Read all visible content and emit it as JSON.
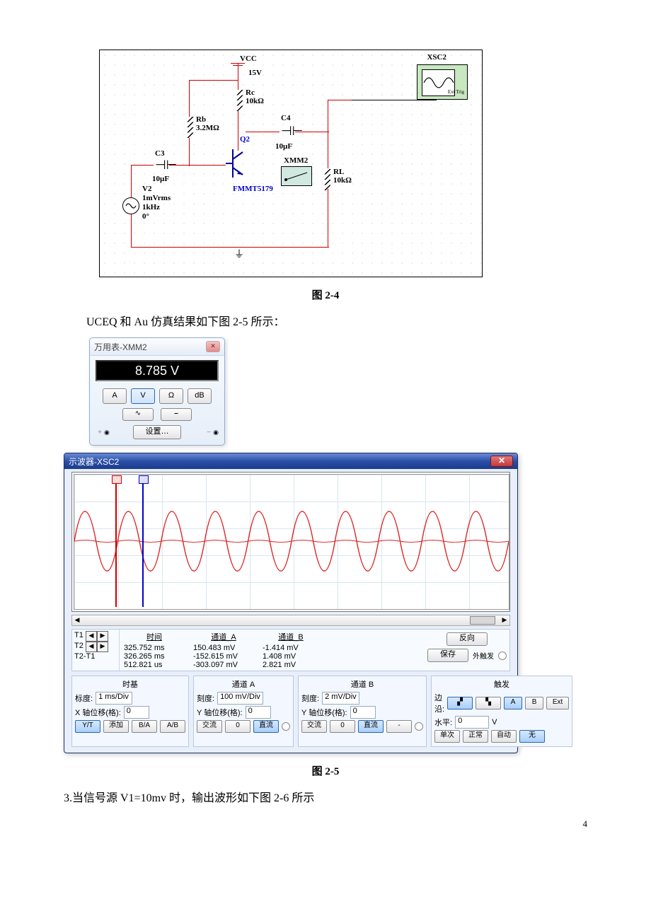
{
  "page_number": "4",
  "circuit": {
    "vcc_label": "VCC",
    "vcc_value": "15V",
    "rc_name": "Rc",
    "rc_value": "10kΩ",
    "rb_name": "Rb",
    "rb_value": "3.2MΩ",
    "c3_name": "C3",
    "c3_value": "10µF",
    "c4_name": "C4",
    "c4_value": "10µF",
    "q2_name": "Q2",
    "q2_model": "FMMT5179",
    "rl_name": "RL",
    "rl_value": "10kΩ",
    "xmm_name": "XMM2",
    "scope_name": "XSC2",
    "scope_ext": "Ext Trig",
    "v2_name": "V2",
    "v2_amp": "1mVrms",
    "v2_freq": "1kHz",
    "v2_phase": "0°"
  },
  "caption_24": "图 2-4",
  "body1": "UCEQ 和 Au 仿真结果如下图 2-5 所示：",
  "caption_25": "图 2-5",
  "body2": "3.当信号源 V1=10mv 时，输出波形如下图 2-6 所示",
  "mm": {
    "title": "万用表-XMM2",
    "reading": "8.785 V",
    "btn_a": "A",
    "btn_v": "V",
    "btn_ohm": "Ω",
    "btn_db": "dB",
    "wave_ac": "∿",
    "wave_dc": "⎯",
    "settings": "设置…",
    "port_plus": "+",
    "port_minus": "−"
  },
  "osc": {
    "title": "示波器-XSC2",
    "readout": {
      "t1": "T1",
      "t2": "T2",
      "t2_t1": "T2-T1",
      "time_hdr": "时间",
      "cha_hdr": "通道_A",
      "chb_hdr": "通道_B",
      "t1_time": "325.752 ms",
      "t2_time": "326.265 ms",
      "dt_time": "512.821 us",
      "t1_cha": "150.483 mV",
      "t2_cha": "-152.615 mV",
      "dt_cha": "-303.097 mV",
      "t1_chb": "-1.414 mV",
      "t2_chb": "1.408 mV",
      "dt_chb": "2.821 mV",
      "btn_rev": "反向",
      "btn_save": "保存",
      "ext_trig": "外触发"
    },
    "timebase": {
      "title": "时基",
      "scale_lbl": "标度:",
      "scale_val": "1 ms/Div",
      "xpos_lbl": "X 轴位移(格):",
      "xpos_val": "0",
      "btn_yt": "Y/T",
      "btn_add": "添加",
      "btn_ba": "B/A",
      "btn_ab": "A/B"
    },
    "chA": {
      "title": "通道 A",
      "scale_lbl": "刻度:",
      "scale_val": "100 mV/Div",
      "ypos_lbl": "Y 轴位移(格):",
      "ypos_val": "0",
      "btn_ac": "交流",
      "btn_zero": "0",
      "btn_dc": "直流"
    },
    "chB": {
      "title": "通道 B",
      "scale_lbl": "刻度:",
      "scale_val": "2 mV/Div",
      "ypos_lbl": "Y 轴位移(格):",
      "ypos_val": "0",
      "btn_ac": "交流",
      "btn_zero": "0",
      "btn_dc": "直流",
      "btn_minus": "-"
    },
    "trigger": {
      "title": "触发",
      "edge_lbl": "边沿:",
      "btn_rise": "▞",
      "btn_fall": "▚",
      "btn_a": "A",
      "btn_b": "B",
      "btn_ext": "Ext",
      "level_lbl": "水平:",
      "level_val": "0",
      "level_unit": "V",
      "btn_single": "单次",
      "btn_normal": "正常",
      "btn_auto": "自动",
      "btn_none": "无"
    }
  }
}
